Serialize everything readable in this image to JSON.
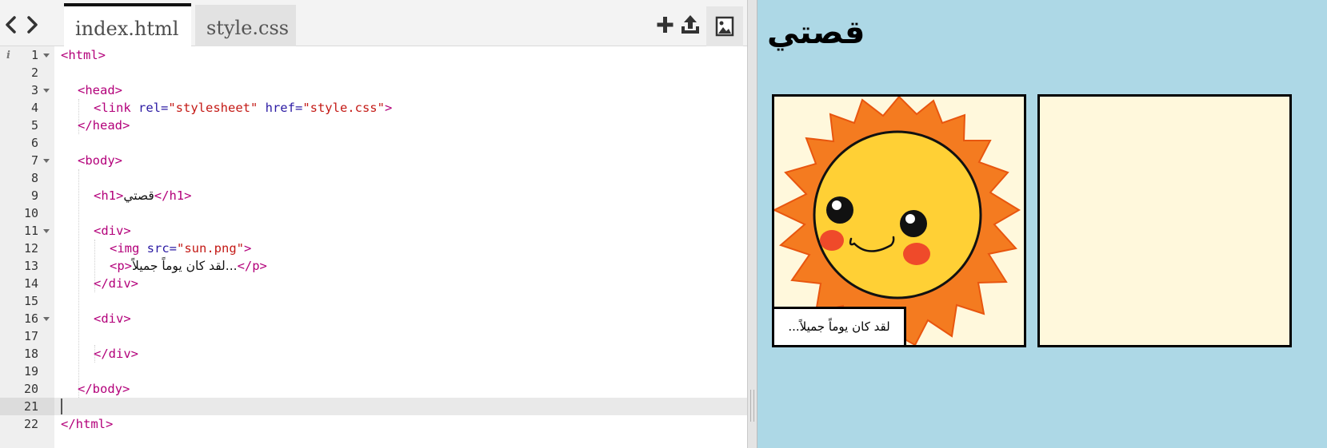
{
  "toolbar": {
    "back_icon": "chevron-left-icon",
    "forward_icon": "chevron-right-icon",
    "tabs": [
      {
        "label": "index.html",
        "active": true
      },
      {
        "label": "style.css",
        "active": false
      }
    ],
    "tools": [
      "add-file-icon",
      "upload-icon",
      "image-icon"
    ]
  },
  "editor": {
    "active_line": 21,
    "lines": [
      {
        "n": "1"
      },
      {
        "n": "2"
      },
      {
        "n": "3"
      },
      {
        "n": "4"
      },
      {
        "n": "5"
      },
      {
        "n": "6"
      },
      {
        "n": "7"
      },
      {
        "n": "8"
      },
      {
        "n": "9"
      },
      {
        "n": "10"
      },
      {
        "n": "11"
      },
      {
        "n": "12"
      },
      {
        "n": "13"
      },
      {
        "n": "14"
      },
      {
        "n": "15"
      },
      {
        "n": "16"
      },
      {
        "n": "17"
      },
      {
        "n": "18"
      },
      {
        "n": "19"
      },
      {
        "n": "20"
      },
      {
        "n": "21"
      },
      {
        "n": "22"
      }
    ],
    "code": {
      "l1": "<html>",
      "l3": "<head>",
      "l4_open": "<link ",
      "l4_attr1": "rel=",
      "l4_val1": "\"stylesheet\"",
      "l4_attr2": " href=",
      "l4_val2": "\"style.css\"",
      "l4_close": ">",
      "l5": "</head>",
      "l7": "<body>",
      "l9_open": "<h1>",
      "l9_text": "قصتي",
      "l9_close": "</h1>",
      "l11": "<div>",
      "l12_open": "<img ",
      "l12_attr": "src=",
      "l12_val": "\"sun.png\"",
      "l12_close": ">",
      "l13_open": "<p>",
      "l13_text": "لقد كان يوماً جميلاً...",
      "l13_close": "</p>",
      "l14": "</div>",
      "l16": "<div>",
      "l18": "</div>",
      "l20": "</body>",
      "l22": "</html>"
    }
  },
  "preview": {
    "title": "قصتي",
    "caption": "لقد كان يوماً جميلاً...",
    "background": "#add8e6",
    "panel_color": "#fff8dc"
  }
}
